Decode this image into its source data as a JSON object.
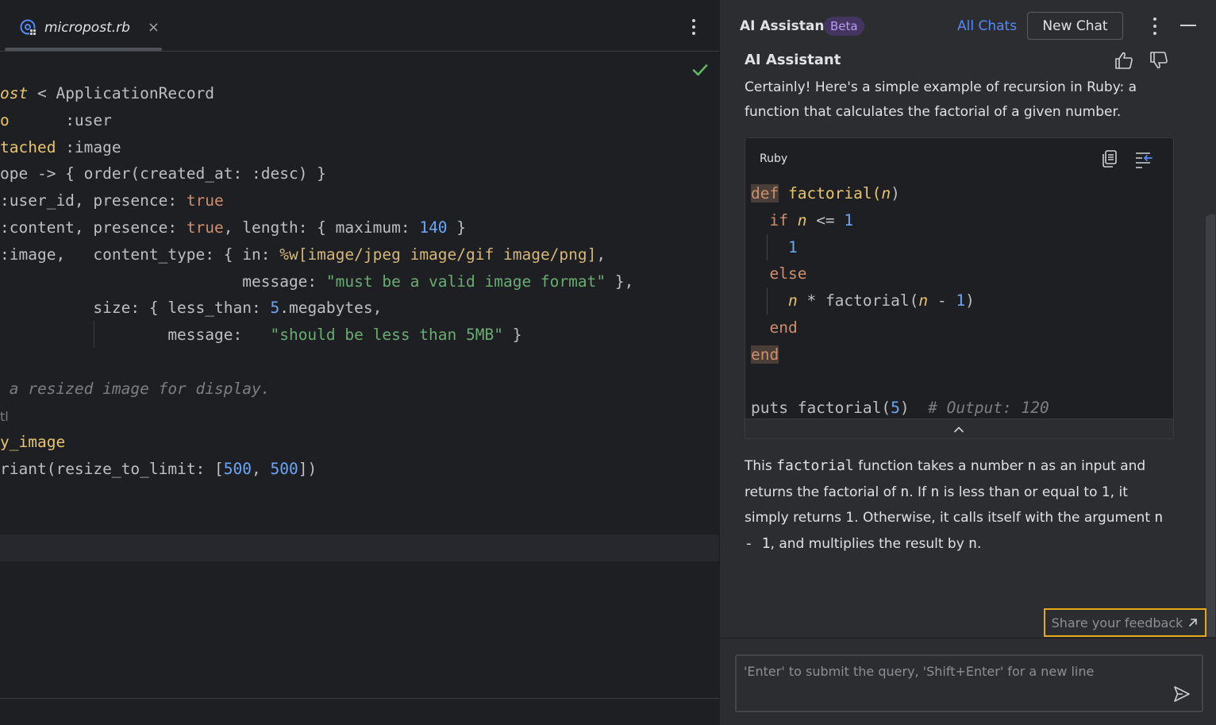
{
  "editor": {
    "tab": {
      "file_name": "micropost.rb",
      "close": "×"
    },
    "lines": [
      {
        "segments": [
          {
            "t": "ost",
            "c": "c-ital"
          },
          {
            "t": " < ApplicationRecord",
            "c": "c-cls"
          }
        ]
      },
      {
        "segments": [
          {
            "t": "o",
            "c": "c-meth"
          },
          {
            "t": "      :user",
            "c": "c-sym"
          }
        ]
      },
      {
        "segments": [
          {
            "t": "tached",
            "c": "c-meth"
          },
          {
            "t": " :image",
            "c": "c-sym"
          }
        ]
      },
      {
        "segments": [
          {
            "t": "ope -> { order(",
            "c": "c-cls"
          },
          {
            "t": "created_at:",
            "c": "c-pkey"
          },
          {
            "t": " :desc) }",
            "c": "c-sym"
          }
        ]
      },
      {
        "segments": [
          {
            "t": ":user_id, ",
            "c": "c-sym"
          },
          {
            "t": "presence: ",
            "c": "c-pkey"
          },
          {
            "t": "true",
            "c": "c-true"
          }
        ]
      },
      {
        "segments": [
          {
            "t": ":content, ",
            "c": "c-sym"
          },
          {
            "t": "presence: ",
            "c": "c-pkey"
          },
          {
            "t": "true",
            "c": "c-true"
          },
          {
            "t": ", length: { maximum: ",
            "c": "c-pkey"
          },
          {
            "t": "140",
            "c": "c-num"
          },
          {
            "t": " }",
            "c": "c-sym"
          }
        ]
      },
      {
        "segments": [
          {
            "t": ":image,   ",
            "c": "c-sym"
          },
          {
            "t": "content_type: { in: ",
            "c": "c-pkey"
          },
          {
            "t": "%w[image/jpeg image/gif image/png]",
            "c": "c-pct"
          },
          {
            "t": ",",
            "c": "c-sym"
          }
        ]
      },
      {
        "segments": [
          {
            "t": "                          message: ",
            "c": "c-pkey"
          },
          {
            "t": "\"must be a valid image format\"",
            "c": "c-str"
          },
          {
            "t": " },",
            "c": "c-sym"
          }
        ]
      },
      {
        "segments": [
          {
            "t": "          size: { less_than: ",
            "c": "c-pkey"
          },
          {
            "t": "5",
            "c": "c-num"
          },
          {
            "t": ".megabytes,",
            "c": "c-sym"
          }
        ]
      },
      {
        "segments": [
          {
            "t": "                  message:   ",
            "c": "c-pkey"
          },
          {
            "t": "\"should be less than 5MB\"",
            "c": "c-str"
          },
          {
            "t": " }",
            "c": "c-sym"
          }
        ]
      },
      {
        "segments": []
      },
      {
        "segments": [
          {
            "t": " a resized image for display.",
            "c": "c-com"
          }
        ]
      },
      {
        "segments": [
          {
            "t": "tl",
            "c": "c-dim"
          }
        ]
      },
      {
        "segments": [
          {
            "t": "y_image",
            "c": "c-meth"
          }
        ]
      },
      {
        "segments": [
          {
            "t": "riant(",
            "c": "c-cls"
          },
          {
            "t": "resize_to_limit: [",
            "c": "c-pkey"
          },
          {
            "t": "500",
            "c": "c-num"
          },
          {
            "t": ", ",
            "c": "c-sym"
          },
          {
            "t": "500",
            "c": "c-num"
          },
          {
            "t": "])",
            "c": "c-sym"
          }
        ]
      }
    ]
  },
  "assistant": {
    "title": "AI Assistant",
    "badge": "Beta",
    "all_chats": "All Chats",
    "new_chat": "New Chat",
    "message": {
      "author": "AI Assistant",
      "intro": "Certainly! Here's a simple example of recursion in Ruby: a function that calculates the factorial of a given number.",
      "code_language": "Ruby",
      "code_lines": [
        {
          "guides": [],
          "segments": [
            {
              "t": "def",
              "c": "c-kw hl"
            },
            {
              "t": " factorial(",
              "c": "c-meth"
            },
            {
              "t": "n",
              "c": "c-ital"
            },
            {
              "t": ")",
              "c": "c-sym"
            }
          ]
        },
        {
          "guides": [],
          "segments": [
            {
              "t": "  if ",
              "c": "c-kw"
            },
            {
              "t": "n",
              "c": "c-ital"
            },
            {
              "t": " <= ",
              "c": "c-sym"
            },
            {
              "t": "1",
              "c": "c-num"
            }
          ]
        },
        {
          "guides": [
            20
          ],
          "segments": [
            {
              "t": "    1",
              "c": "c-num"
            }
          ]
        },
        {
          "guides": [],
          "segments": [
            {
              "t": "  else",
              "c": "c-kw"
            }
          ]
        },
        {
          "guides": [
            20
          ],
          "segments": [
            {
              "t": "    ",
              "c": "c-sym"
            },
            {
              "t": "n",
              "c": "c-ital"
            },
            {
              "t": " * factorial(",
              "c": "c-sym"
            },
            {
              "t": "n",
              "c": "c-ital"
            },
            {
              "t": " - ",
              "c": "c-sym"
            },
            {
              "t": "1",
              "c": "c-num"
            },
            {
              "t": ")",
              "c": "c-sym"
            }
          ]
        },
        {
          "guides": [],
          "segments": [
            {
              "t": "  end",
              "c": "c-kw"
            }
          ]
        },
        {
          "guides": [],
          "segments": [
            {
              "t": "end",
              "c": "c-kw hl"
            }
          ]
        },
        {
          "guides": [],
          "segments": []
        },
        {
          "guides": [],
          "segments": [
            {
              "t": "puts factorial(",
              "c": "c-sym"
            },
            {
              "t": "5",
              "c": "c-num"
            },
            {
              "t": ")  ",
              "c": "c-sym"
            },
            {
              "t": "# Output: 120",
              "c": "c-com"
            }
          ]
        }
      ],
      "outro": [
        {
          "t": "This ",
          "code": false
        },
        {
          "t": "factorial",
          "code": true
        },
        {
          "t": " function takes a number ",
          "code": false
        },
        {
          "t": "n",
          "code": true
        },
        {
          "t": " as an input and returns the factorial of ",
          "code": false
        },
        {
          "t": "n",
          "code": true
        },
        {
          "t": ". If ",
          "code": false
        },
        {
          "t": "n",
          "code": true
        },
        {
          "t": " is less than or equal to 1, it simply returns 1. Otherwise, it calls itself with the argument ",
          "code": false
        },
        {
          "t": "n - 1",
          "code": true
        },
        {
          "t": ", and multiplies the result by ",
          "code": false
        },
        {
          "t": "n",
          "code": true
        },
        {
          "t": ".",
          "code": false
        }
      ]
    },
    "feedback_label": "Share your feedback",
    "input_placeholder": "'Enter' to submit the query, 'Shift+Enter' for a new line"
  },
  "colors": {
    "accent": "#548af7",
    "highlight_border": "#e6a817",
    "success": "#5fb865",
    "badge_bg": "#43355f"
  },
  "icons": {
    "file": "ruby-file-icon",
    "check": "check-icon",
    "thumb_up": "thumbs-up-icon",
    "thumb_down": "thumbs-down-icon",
    "copy": "copy-icon",
    "insert": "insert-snippet-icon",
    "collapse": "chevron-up-icon",
    "send": "send-icon",
    "external": "external-link-icon"
  }
}
